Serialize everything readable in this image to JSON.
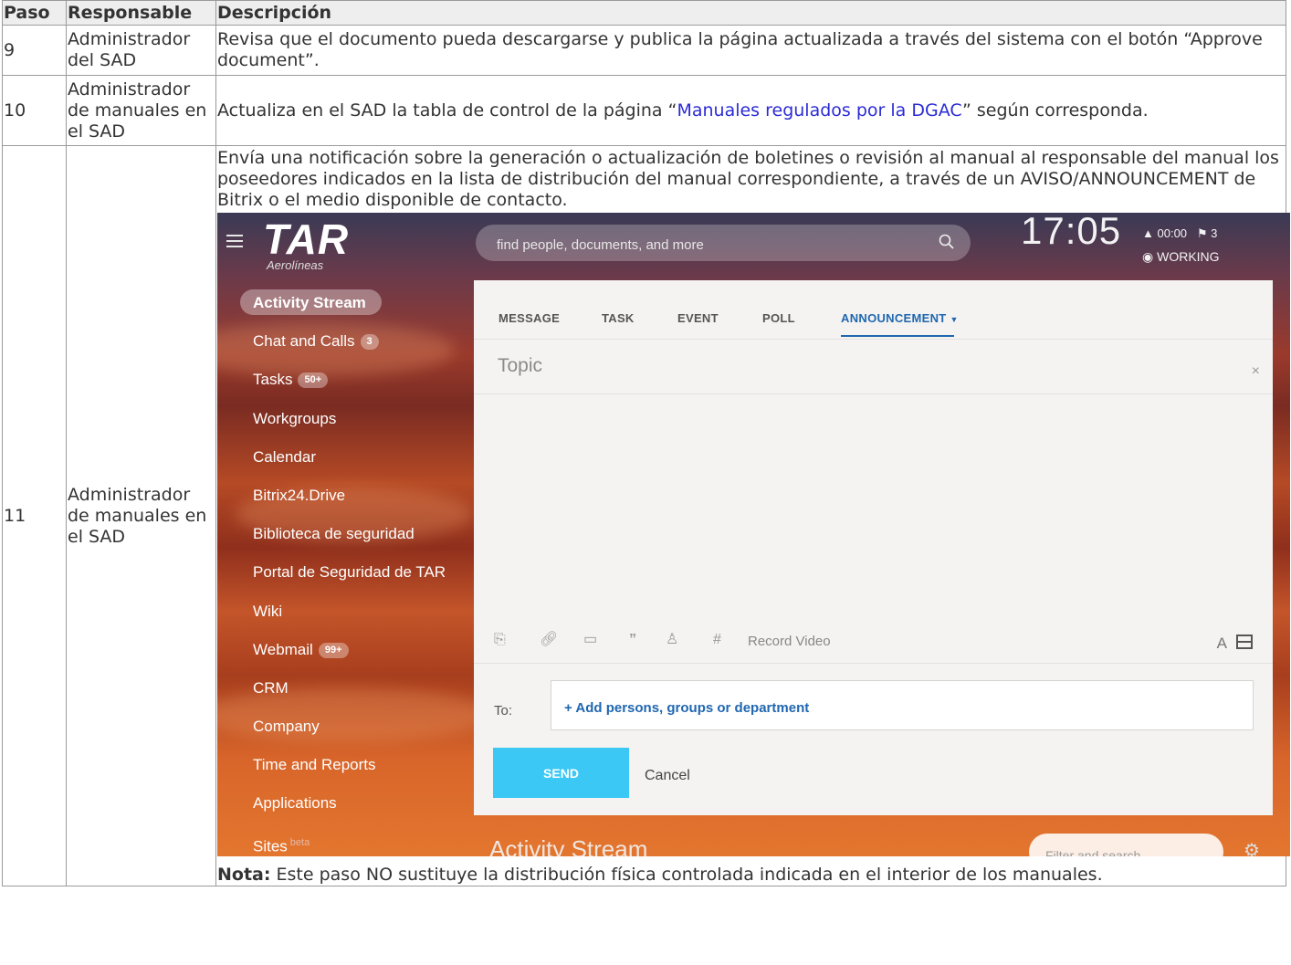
{
  "table": {
    "headers": {
      "step": "Paso",
      "responsible": "Responsable",
      "description": "Descripción"
    },
    "rows": [
      {
        "step": "9",
        "responsible": "Administrador del SAD",
        "description": "Revisa que el documento pueda descargarse y publica la página actualizada a través del sistema con el botón “Approve document”."
      },
      {
        "step": "10",
        "responsible": "Administrador de manuales en el SAD",
        "description_pre": "Actualiza en el SAD la tabla de control de la página “",
        "description_link": "Manuales regulados por la DGAC",
        "description_post": "” según corresponda."
      },
      {
        "step": "11",
        "responsible": "Administrador de manuales en el SAD",
        "description": "Envía una notificación sobre la generación o actualización de boletines o revisión al manual al responsable del manual los poseedores indicados en la lista de distribución del manual correspondiente, a través de un AVISO/ANNOUNCEMENT de Bitrix o el medio disponible de contacto.",
        "note_label": "Nota:",
        "note_text": " Este paso NO sustituye la distribución física controlada indicada en el interior de los manuales."
      }
    ]
  },
  "screenshot": {
    "logo": {
      "mark": "TAR",
      "sub": "Aerolíneas"
    },
    "search_placeholder": "find people, documents, and more",
    "clock": "17:05",
    "alarm": "00:00",
    "flag_count": "3",
    "status": "WORKING",
    "nav": [
      {
        "label": "Activity Stream",
        "badge": "",
        "sup": "",
        "active": true
      },
      {
        "label": "Chat and Calls",
        "badge": "3",
        "sup": ""
      },
      {
        "label": "Tasks",
        "badge": "50+",
        "sup": ""
      },
      {
        "label": "Workgroups",
        "badge": "",
        "sup": ""
      },
      {
        "label": "Calendar",
        "badge": "",
        "sup": ""
      },
      {
        "label": "Bitrix24.Drive",
        "badge": "",
        "sup": ""
      },
      {
        "label": "Biblioteca de seguridad",
        "badge": "",
        "sup": ""
      },
      {
        "label": "Portal de Seguridad de TAR",
        "badge": "",
        "sup": ""
      },
      {
        "label": "Wiki",
        "badge": "",
        "sup": ""
      },
      {
        "label": "Webmail",
        "badge": "99+",
        "sup": ""
      },
      {
        "label": "CRM",
        "badge": "",
        "sup": ""
      },
      {
        "label": "Company",
        "badge": "",
        "sup": ""
      },
      {
        "label": "Time and Reports",
        "badge": "",
        "sup": ""
      },
      {
        "label": "Applications",
        "badge": "",
        "sup": ""
      },
      {
        "label": "Sites",
        "badge": "",
        "sup": "beta"
      }
    ],
    "tabs": [
      "MESSAGE",
      "TASK",
      "EVENT",
      "POLL",
      "ANNOUNCEMENT"
    ],
    "topic_placeholder": "Topic",
    "record_video": "Record Video",
    "format_letter": "A",
    "to_label": "To:",
    "add_persons": "+ Add persons, groups or department",
    "send": "SEND",
    "cancel": "Cancel",
    "stream_title": "Activity Stream",
    "filter_placeholder": "Filter and search",
    "colors": {
      "accent": "#2067b0",
      "send": "#3bc8f5",
      "link": "#2b2bd6"
    }
  }
}
